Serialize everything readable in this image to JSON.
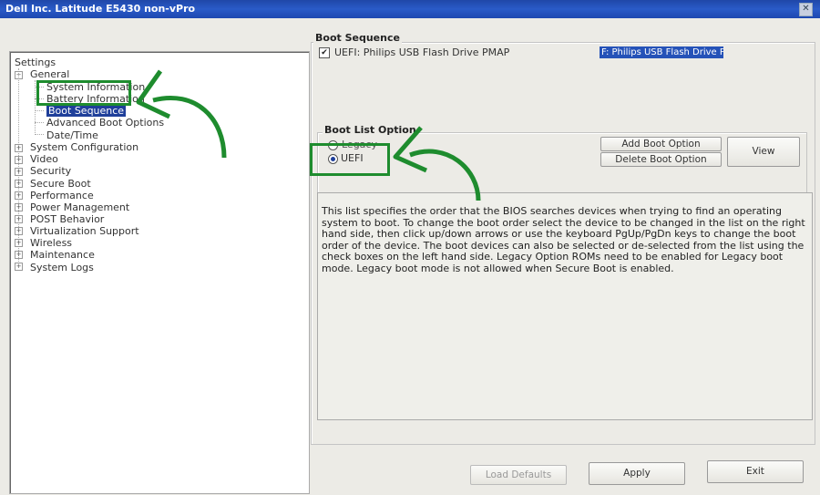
{
  "window": {
    "title": "Dell Inc. Latitude E5430 non-vPro",
    "close_glyph": "✕"
  },
  "tree": {
    "root": "Settings",
    "general": "General",
    "general_children": [
      "System Information",
      "Battery Information",
      "Boot Sequence",
      "Advanced Boot Options",
      "Date/Time"
    ],
    "sections": [
      "System Configuration",
      "Video",
      "Security",
      "Secure Boot",
      "Performance",
      "Power Management",
      "POST Behavior",
      "Virtualization Support",
      "Wireless",
      "Maintenance",
      "System Logs"
    ]
  },
  "boot_sequence": {
    "title": "Boot Sequence",
    "item_label": "UEFI: Philips USB Flash Drive PMAP",
    "item_checked": true,
    "selected_entry": "F: Philips USB Flash Drive PM"
  },
  "boot_list": {
    "title": "Boot List Option",
    "legacy_label": "Legacy",
    "uefi_label": "UEFI",
    "selected": "UEFI",
    "add_button": "Add Boot Option",
    "delete_button": "Delete Boot Option",
    "view_button": "View"
  },
  "help_text": "This list specifies the order that the BIOS searches devices when trying to find an operating system to boot. To change the boot order select the device to be changed in the list on the right hand side, then click up/down arrows or use the keyboard PgUp/PgDn keys to change the boot order of the device. The boot devices can also be selected or de-selected from the list using the check boxes on the left hand side. Legacy Option ROMs need to be enabled for Legacy boot mode. Legacy boot mode is not allowed when Secure Boot is enabled.",
  "footer": {
    "load_defaults": "Load Defaults",
    "apply": "Apply",
    "exit": "Exit"
  },
  "annotation_color": "#1e8c2e",
  "selection_color": "#1f3f9a"
}
